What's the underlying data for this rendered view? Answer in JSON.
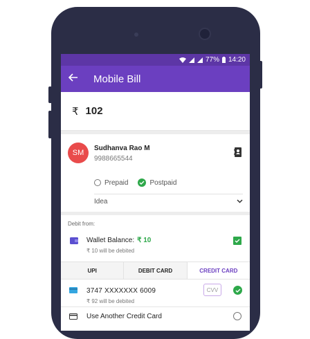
{
  "status_bar": {
    "battery": "77%",
    "time": "14:20"
  },
  "app_bar": {
    "title": "Mobile Bill"
  },
  "amount": {
    "currency": "₹",
    "value": "102"
  },
  "contact": {
    "initials": "SM",
    "name": "Sudhanva Rao M",
    "phone": "9988665544",
    "plan_options": [
      "Prepaid",
      "Postpaid"
    ],
    "selected_plan": "Postpaid",
    "operator": "Idea"
  },
  "payment": {
    "debit_label": "Debit from:",
    "wallet_label": "Wallet Balance:",
    "wallet_amount": "₹ 10",
    "wallet_debit_note": "₹ 10 will be debited",
    "tabs": [
      "UPI",
      "DEBIT CARD",
      "CREDIT CARD"
    ],
    "active_tab": "CREDIT CARD",
    "saved_card": {
      "number": "3747 XXXXXXX 6009",
      "debit_note": "₹ 92 will be debited",
      "cvv_placeholder": "CVV"
    },
    "another_card_label": "Use Another Credit Card"
  },
  "colors": {
    "primary": "#6b3fc0",
    "status_bar": "#5d36a6",
    "success": "#2ea84a",
    "avatar": "#e94b4b"
  }
}
